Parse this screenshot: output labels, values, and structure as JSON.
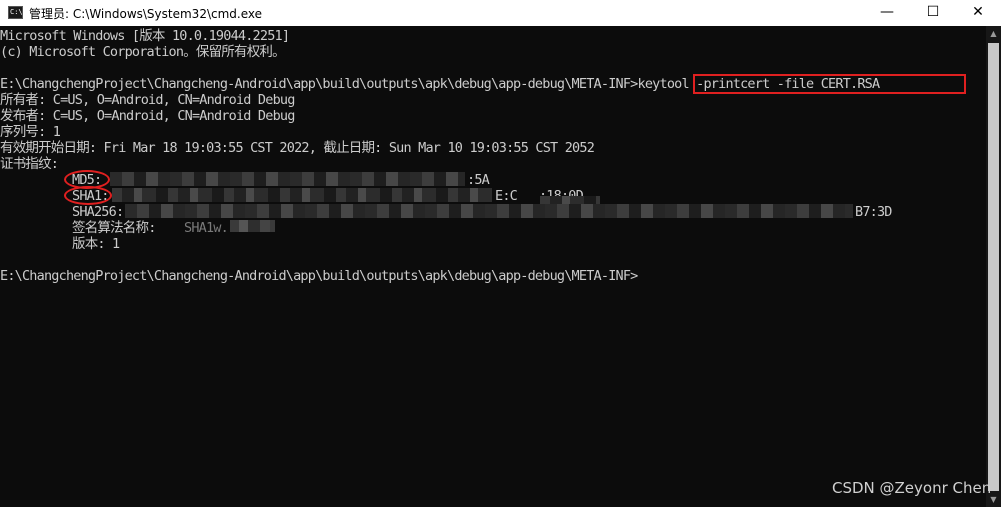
{
  "window": {
    "title": "管理员: C:\\Windows\\System32\\cmd.exe",
    "icon_label": "C:\\",
    "minimize_glyph": "—",
    "maximize_glyph": "☐",
    "close_glyph": "✕"
  },
  "console": {
    "lines": [
      "Microsoft Windows [版本 10.0.19044.2251]",
      "(c) Microsoft Corporation。保留所有权利。",
      "",
      "E:\\ChangchengProject\\Changcheng-Android\\app\\build\\outputs\\apk\\debug\\app-debug\\META-INF>keytool -printcert -file CERT.RSA",
      "所有者: C=US, O=Android, CN=Android Debug",
      "发布者: C=US, O=Android, CN=Android Debug",
      "序列号: 1",
      "有效期开始日期: Fri Mar 18 19:03:55 CST 2022, 截止日期: Sun Mar 10 19:03:55 CST 2052",
      "证书指纹:",
      "MD5:",
      "SHA1:",
      "SHA256:",
      "签名算法名称:",
      "版本: 1",
      "",
      "E:\\ChangchengProject\\Changcheng-Android\\app\\build\\outputs\\apk\\debug\\app-debug\\META-INF>"
    ],
    "prompt": "E:\\ChangchengProject\\Changcheng-Android\\app\\build\\outputs\\apk\\debug\\app-debug\\META-INF>",
    "command": "keytool -printcert -file CERT.RSA",
    "visible_fragments": {
      "md5_tail": ":5A",
      "sha1_tail": "E:C   :18:0D",
      "sha256_tail": "B7:3D",
      "sig_alg_partial": "SHA1w..."
    }
  },
  "watermark": "CSDN @Zeyonr Chen",
  "colors": {
    "console_bg": "#0c0c0c",
    "console_text": "#cccccc",
    "annotation": "#e02020"
  }
}
